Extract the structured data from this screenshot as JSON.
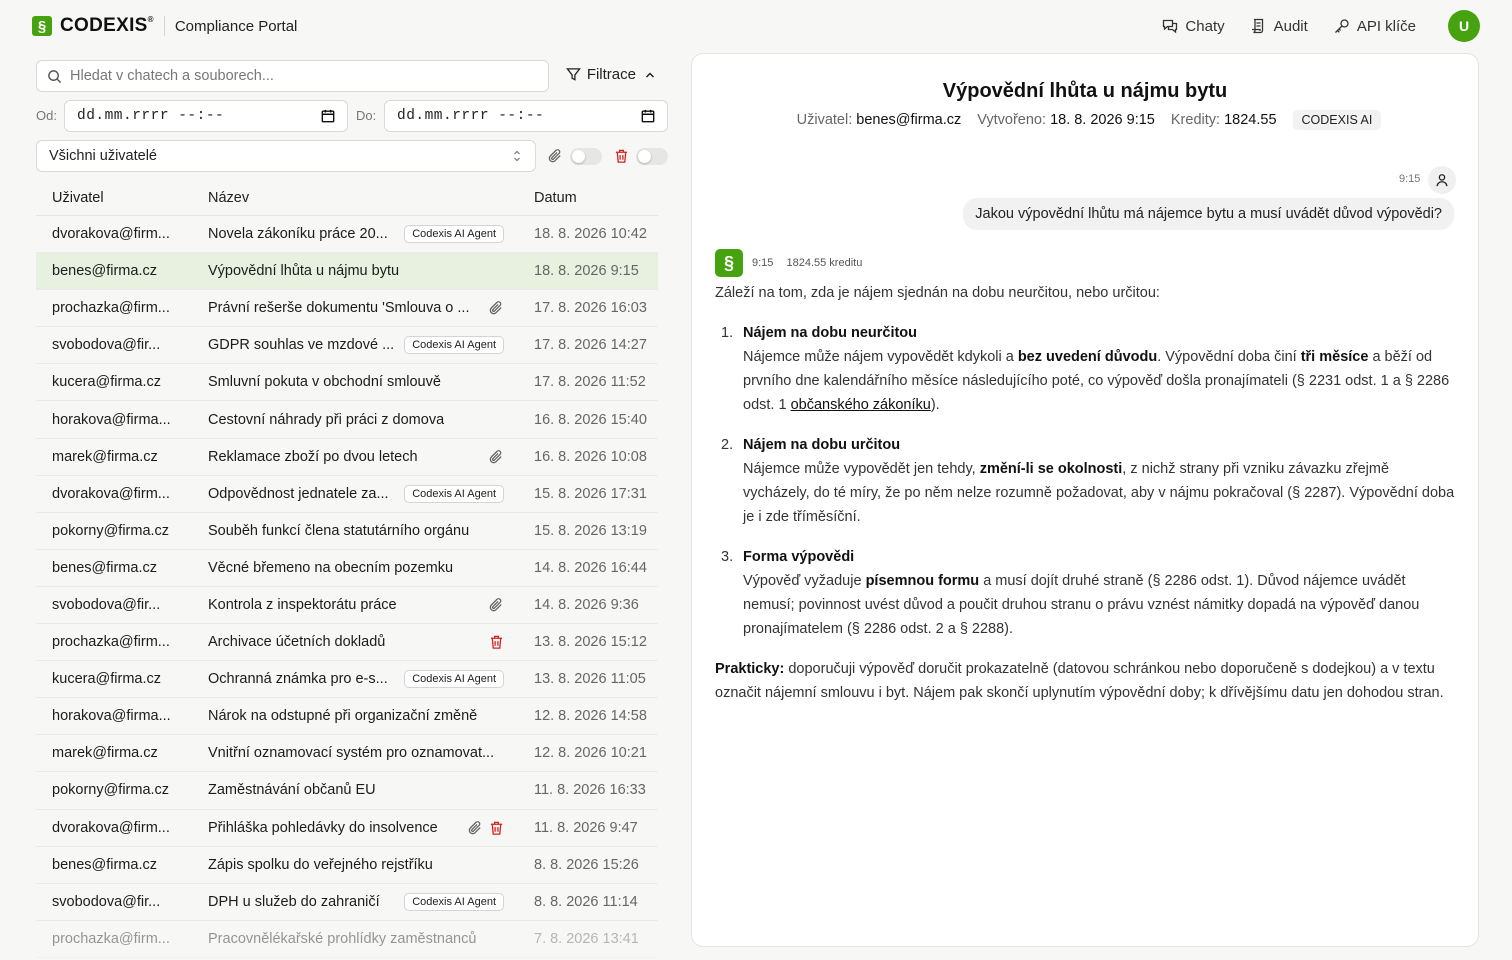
{
  "header": {
    "logo_text": "CODEXIS",
    "logo_reg": "®",
    "logo_glyph": "§",
    "portal_name": "Compliance Portal",
    "nav": [
      {
        "label": "Chaty",
        "icon": "chat-icon"
      },
      {
        "label": "Audit",
        "icon": "audit-icon"
      },
      {
        "label": "API klíče",
        "icon": "key-icon"
      }
    ],
    "avatar_initial": "U",
    "accent": "#46a30f"
  },
  "filters": {
    "search_placeholder": "Hledat v chatech a souborech...",
    "filter_label": "Filtrace",
    "from_label": "Od:",
    "to_label": "Do:",
    "from_value": "dd.mm.rrrr --:--",
    "to_value": "dd.mm.rrrr --:--",
    "user_select": "Všichni uživatelé"
  },
  "table": {
    "headers": {
      "user": "Uživatel",
      "name": "Název",
      "date": "Datum"
    },
    "rows": [
      {
        "user": "dvorakova@firm...",
        "name": "Novela zákoníku práce 20...",
        "badge": "Codexis AI Agent",
        "date": "18. 8. 2026 10:42"
      },
      {
        "user": "benes@firma.cz",
        "name": "Výpovědní lhůta u nájmu bytu",
        "badge": "",
        "date": "18. 8. 2026 9:15"
      },
      {
        "user": "prochazka@firm...",
        "name": "Právní rešerše dokumentu 'Smlouva o ...",
        "badge": "",
        "date": "17. 8. 2026 16:03"
      },
      {
        "user": "svobodova@fir...",
        "name": "GDPR souhlas ve mzdové ...",
        "badge": "Codexis AI Agent",
        "date": "17. 8. 2026 14:27"
      },
      {
        "user": "kucera@firma.cz",
        "name": "Smluvní pokuta v obchodní smlouvě",
        "badge": "",
        "date": "17. 8. 2026 11:52"
      },
      {
        "user": "horakova@firma...",
        "name": "Cestovní náhrady při práci z domova",
        "badge": "",
        "date": "16. 8. 2026 15:40"
      },
      {
        "user": "marek@firma.cz",
        "name": "Reklamace zboží po dvou letech",
        "badge": "",
        "date": "16. 8. 2026 10:08"
      },
      {
        "user": "dvorakova@firm...",
        "name": "Odpovědnost jednatele za...",
        "badge": "Codexis AI Agent",
        "date": "15. 8. 2026 17:31"
      },
      {
        "user": "pokorny@firma.cz",
        "name": "Souběh funkcí člena statutárního orgánu",
        "badge": "",
        "date": "15. 8. 2026 13:19"
      },
      {
        "user": "benes@firma.cz",
        "name": "Věcné břemeno na obecním pozemku",
        "badge": "",
        "date": "14. 8. 2026 16:44"
      },
      {
        "user": "svobodova@fir...",
        "name": "Kontrola z inspektorátu práce",
        "badge": "",
        "date": "14. 8. 2026 9:36"
      },
      {
        "user": "prochazka@firm...",
        "name": "Archivace účetních dokladů",
        "badge": "",
        "date": "13. 8. 2026 15:12"
      },
      {
        "user": "kucera@firma.cz",
        "name": "Ochranná známka pro e-s...",
        "badge": "Codexis AI Agent",
        "date": "13. 8. 2026 11:05"
      },
      {
        "user": "horakova@firma...",
        "name": "Nárok na odstupné při organizační změně",
        "badge": "",
        "date": "12. 8. 2026 14:58"
      },
      {
        "user": "marek@firma.cz",
        "name": "Vnitřní oznamovací systém pro oznamovat...",
        "badge": "",
        "date": "12. 8. 2026 10:21"
      },
      {
        "user": "pokorny@firma.cz",
        "name": "Zaměstnávání občanů EU",
        "badge": "",
        "date": "11. 8. 2026 16:33"
      },
      {
        "user": "dvorakova@firm...",
        "name": "Přihláška pohledávky do insolvence",
        "badge": "",
        "date": "11. 8. 2026 9:47"
      },
      {
        "user": "benes@firma.cz",
        "name": "Zápis spolku do veřejného rejstříku",
        "badge": "",
        "date": "8. 8. 2026 15:26"
      },
      {
        "user": "svobodova@fir...",
        "name": "DPH u služeb do zahraničí",
        "badge": "Codexis AI Agent",
        "date": "8. 8. 2026 11:14"
      },
      {
        "user": "prochazka@firm...",
        "name": "Pracovnělékařské prohlídky zaměstnanců",
        "badge": "",
        "date": "7. 8. 2026 13:41"
      }
    ]
  },
  "chat": {
    "title": "Výpovědní lhůta u nájmu bytu",
    "meta": {
      "user_label": "Uživatel:",
      "user": "benes@firma.cz",
      "created_label": "Vytvořeno:",
      "created": "18. 8. 2026 9:15",
      "credits_label": "Kredity:",
      "credits": "1824.55",
      "tag": "CODEXIS AI"
    },
    "user_msg": {
      "time": "9:15",
      "text": "Jakou výpovědní lhůtu má nájemce bytu a musí uvádět důvod výpovědi?"
    },
    "assistant": {
      "glyph": "§",
      "time": "9:15",
      "credits": "1824.55 kreditu",
      "intro": "Záleží na tom, zda je nájem sjednán na dobu neurčitou, nebo určitou:",
      "items": [
        {
          "num": "1.",
          "heading": "Nájem na dobu neurčitou",
          "t1": "Nájemce může nájem vypovědět kdykoli a ",
          "b1": "bez uvedení důvodu",
          "t2": ". Výpovědní doba činí ",
          "b2": "tři měsíce",
          "t3": " a běží od prvního dne kalendářního měsíce následujícího poté, co výpověď došla pronajímateli (§ 2231 odst. 1 a § 2286 odst. 1 ",
          "link": "občanského zákoníku",
          "t4": ")."
        },
        {
          "num": "2.",
          "heading": "Nájem na dobu určitou",
          "t1": "Nájemce může vypovědět jen tehdy, ",
          "b1": "změní-li se okolnosti",
          "t2": ", z nichž strany při vzniku závazku zřejmě vycházely, do té míry, že po něm nelze rozumně požadovat, aby v nájmu pokračoval (§ 2287). Výpovědní doba je i zde tříměsíční."
        },
        {
          "num": "3.",
          "heading": "Forma výpovědi",
          "t1": "Výpověď vyžaduje ",
          "b1": "písemnou formu",
          "t2": " a musí dojít druhé straně (§ 2286 odst. 1). Důvod nájemce uvádět nemusí; povinnost uvést důvod a poučit druhou stranu o právu vznést námitky dopadá na výpověď danou pronajímatelem (§ 2286 odst. 2 a § 2288)."
        }
      ],
      "practical_label": "Prakticky:",
      "practical_text": " doporučuji výpověď doručit prokazatelně (datovou schránkou nebo doporučeně s dodejkou) a v textu označit nájemní smlouvu i byt. Nájem pak skončí uplynutím výpovědní doby; k dřívějšímu datu jen dohodou stran."
    }
  }
}
